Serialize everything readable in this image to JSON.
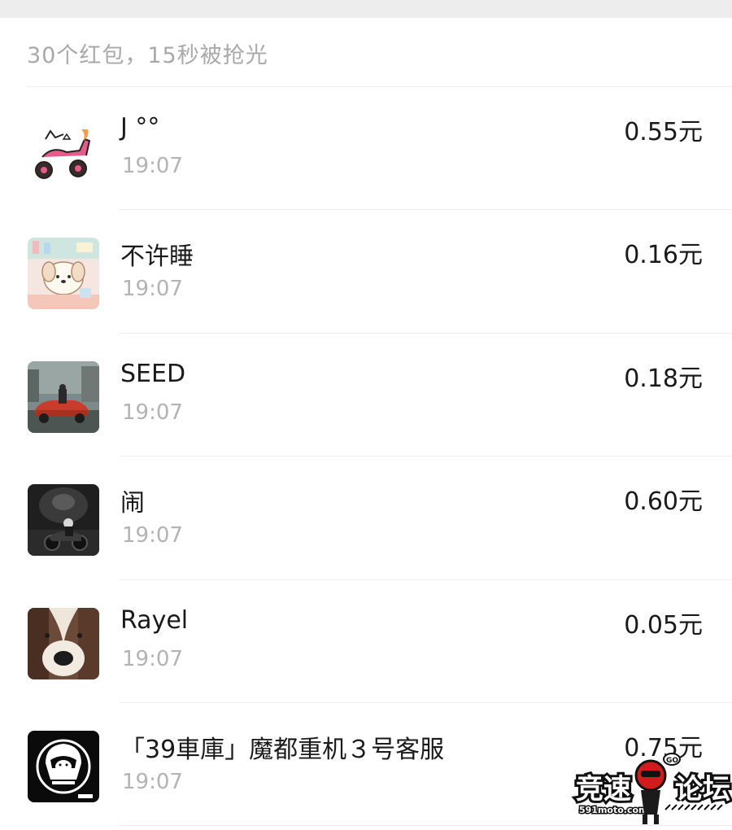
{
  "summary": "30个红包，15秒被抢光",
  "rows": [
    {
      "name": "J °°",
      "time": "19:07",
      "amount": "0.55元",
      "avatar": "scooter-avatar"
    },
    {
      "name": "不许睡",
      "time": "19:07",
      "amount": "0.16元",
      "avatar": "puppy-cartoon-avatar"
    },
    {
      "name": "SEED",
      "time": "19:07",
      "amount": "0.18元",
      "avatar": "car-photo-avatar"
    },
    {
      "name": "闹",
      "time": "19:07",
      "amount": "0.60元",
      "avatar": "motorcycle-night-avatar"
    },
    {
      "name": "Rayel",
      "time": "19:07",
      "amount": "0.05元",
      "avatar": "dog-photo-avatar"
    },
    {
      "name": "「39車庫」魔都重机３号客服",
      "time": "19:07",
      "amount": "0.75元",
      "avatar": "helmet-logo-avatar"
    }
  ],
  "watermark": {
    "text": "竞速论坛",
    "subtext": "591moto.com",
    "badge": "GO"
  }
}
